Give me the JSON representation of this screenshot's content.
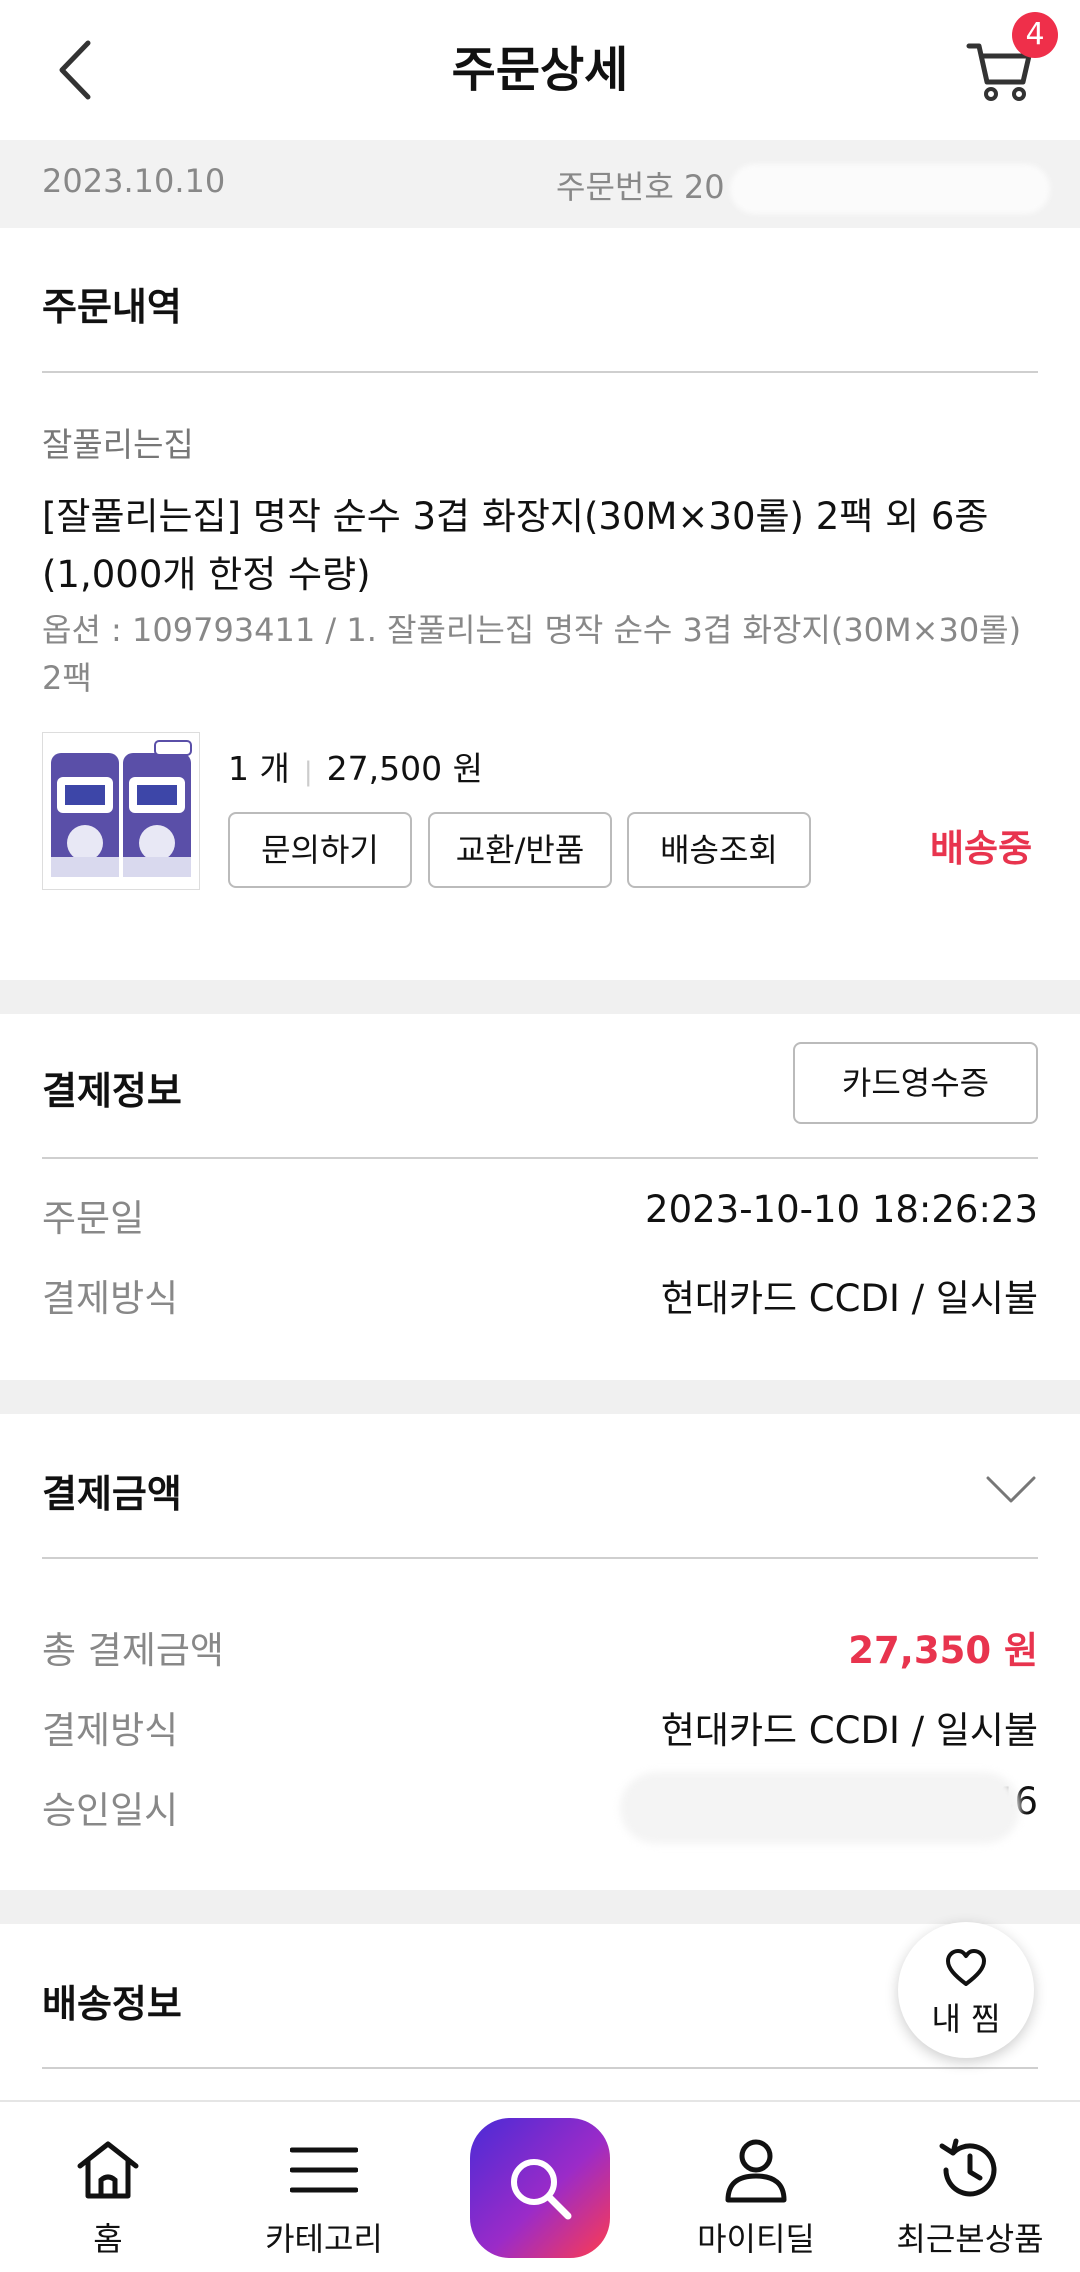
{
  "header": {
    "title": "주문상세",
    "cart_count": "4"
  },
  "order_bar": {
    "date": "2023.10.10",
    "order_number_label": "주문번호 20"
  },
  "order_details": {
    "title": "주문내역",
    "seller": "잘풀리는집",
    "product_name": "[잘풀리는집] 명작 순수 3겹 화장지(30M×30롤) 2팩 외 6종 (1,000개 한정 수량)",
    "option": "옵션 : 109793411 / 1. 잘풀리는집 명작 순수 3겹 화장지(30M×30롤) 2팩",
    "quantity": "1 개",
    "price": "27,500 원",
    "buttons": {
      "inquiry": "문의하기",
      "exchange": "교환/반품",
      "tracking": "배송조회"
    },
    "status": "배송중",
    "status_color": "#e8344e"
  },
  "payment_info": {
    "title": "결제정보",
    "receipt_button": "카드영수증",
    "order_date_label": "주문일",
    "order_date_value": "2023-10-10 18:26:23",
    "method_label": "결제방식",
    "method_value": "현대카드 CCDI / 일시불"
  },
  "payment_amount": {
    "title": "결제금액",
    "total_label": "총 결제금액",
    "total_value": "27,350 원",
    "method_label": "결제방식",
    "method_value": "현대카드 CCDI / 일시불",
    "approval_label": "승인일시",
    "approval_value_partial": ":46"
  },
  "shipping_info": {
    "title": "배송정보"
  },
  "floating": {
    "wishlist_label": "내 찜"
  },
  "bottom_nav": {
    "home": "홈",
    "category": "카테고리",
    "my": "마이티딜",
    "recent": "최근본상품"
  },
  "icons": {
    "back": "back-arrow-icon",
    "cart": "cart-icon",
    "chevron": "chevron-down-icon",
    "heart": "heart-icon",
    "home": "home-icon",
    "menu": "menu-icon",
    "search": "search-icon",
    "user": "user-icon",
    "history": "history-icon"
  }
}
